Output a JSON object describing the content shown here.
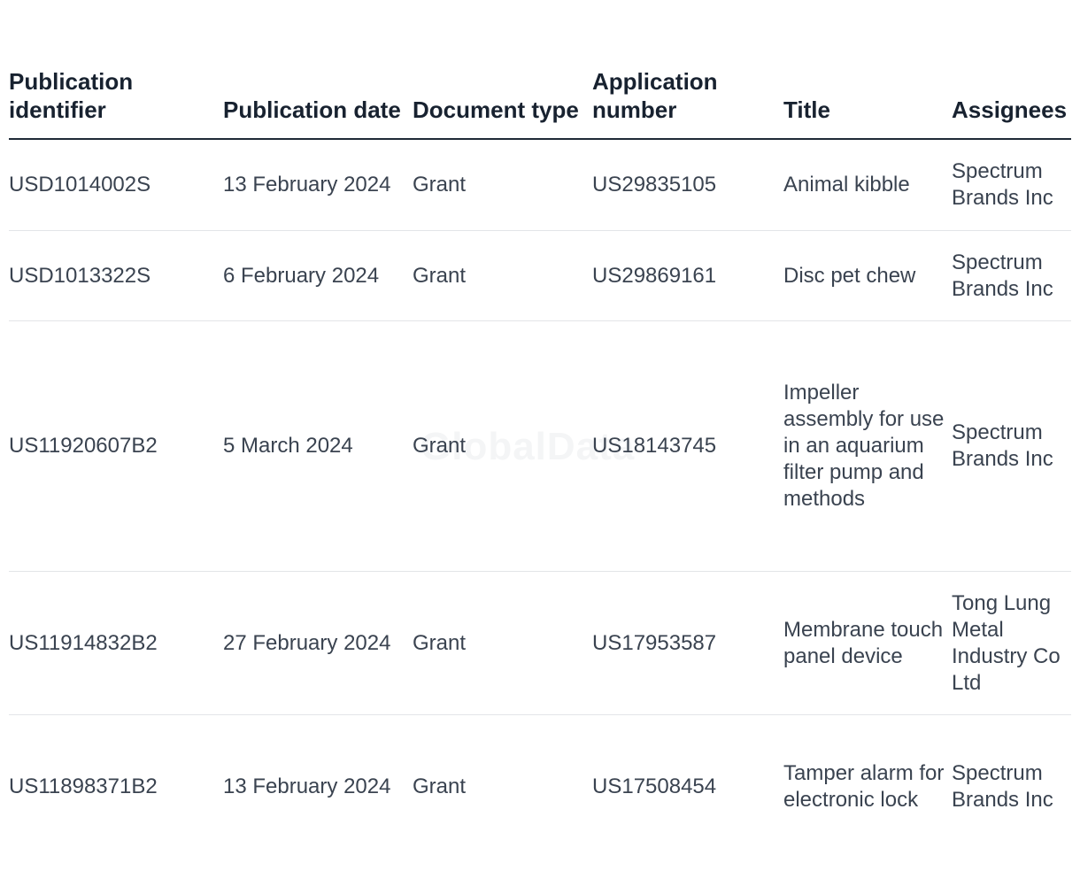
{
  "table": {
    "headers": [
      "Publication identifier",
      "Publication date",
      "Document type",
      "Application number",
      "Title",
      "Assignees"
    ],
    "rows": [
      [
        "USD1014002S",
        "13 February 2024",
        "Grant",
        "US29835105",
        "Animal kibble",
        "Spectrum Brands Inc"
      ],
      [
        "USD1013322S",
        "6 February 2024",
        "Grant",
        "US29869161",
        "Disc pet chew",
        "Spectrum Brands Inc"
      ],
      [
        "US11920607B2",
        "5 March 2024",
        "Grant",
        "US18143745",
        "Impeller assembly for use in an aquarium filter pump and methods",
        "Spectrum Brands Inc"
      ],
      [
        "US11914832B2",
        "27 February 2024",
        "Grant",
        "US17953587",
        "Membrane touch panel device",
        "Tong Lung Metal Industry Co Ltd"
      ],
      [
        "US11898371B2",
        "13 February 2024",
        "Grant",
        "US17508454",
        "Tamper alarm for electronic lock",
        "Spectrum Brands Inc"
      ]
    ]
  },
  "watermark": "GlobalData"
}
